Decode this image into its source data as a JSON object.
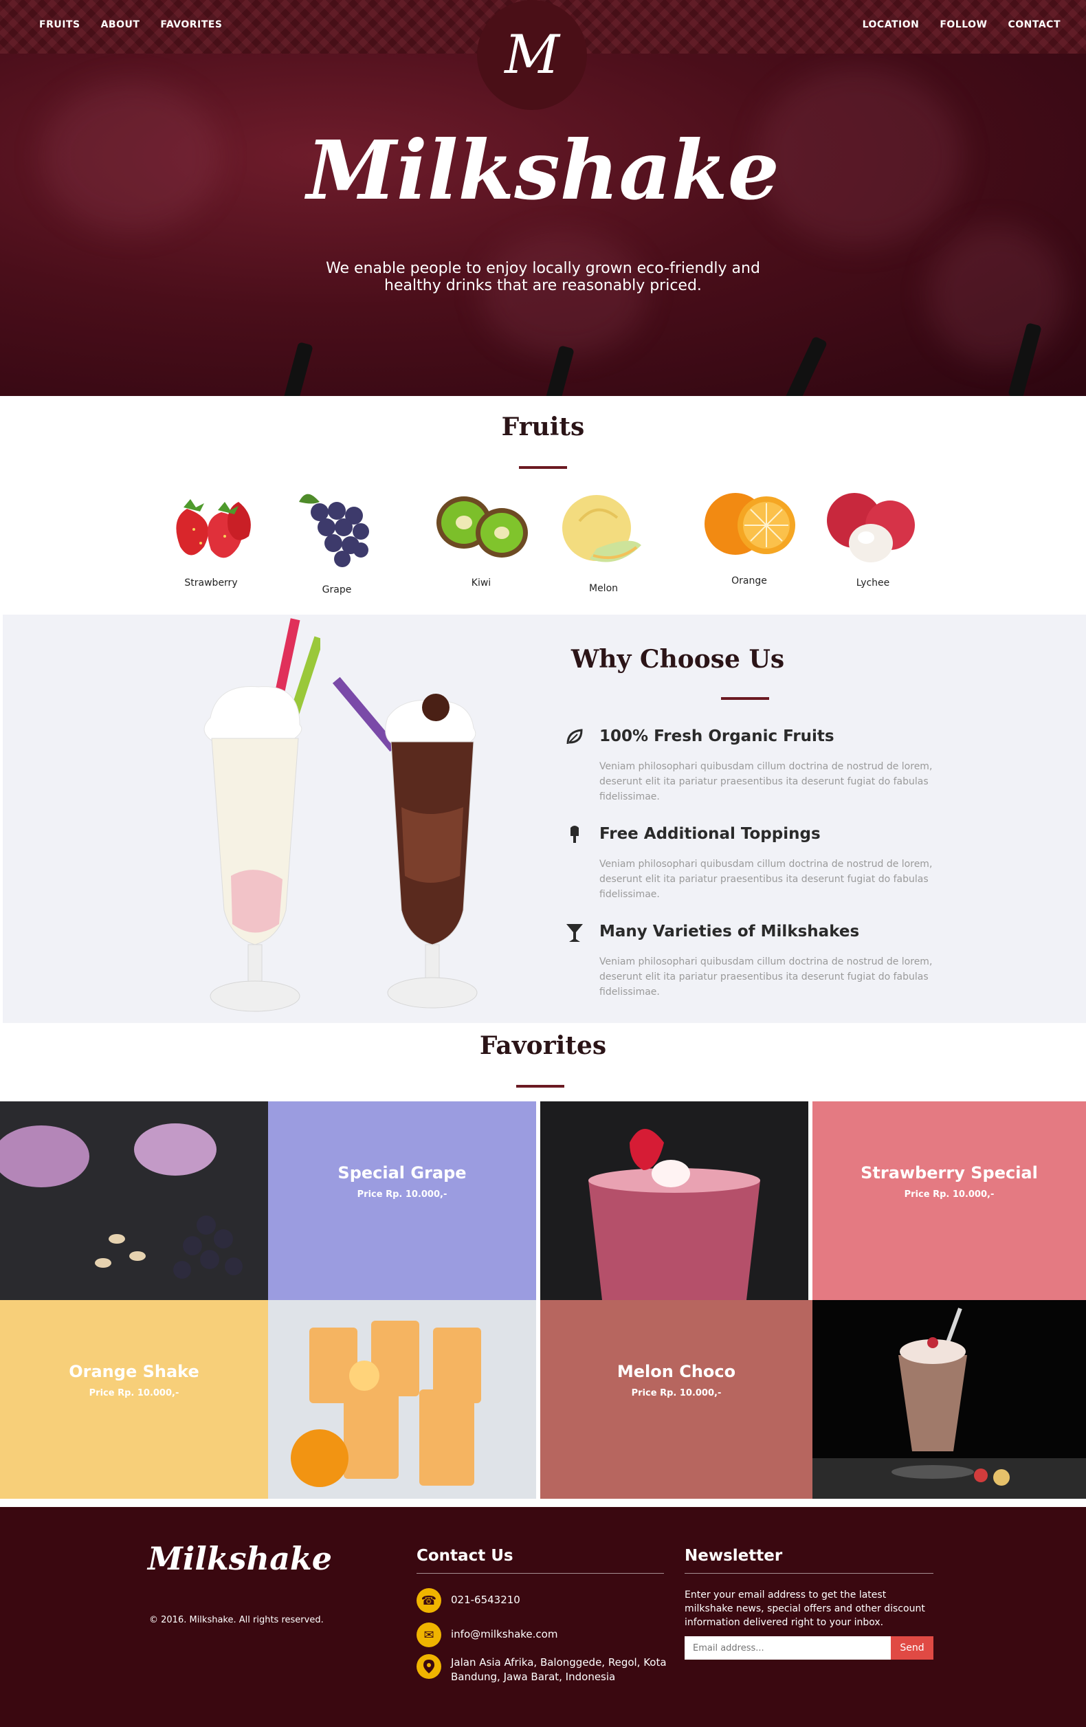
{
  "nav": {
    "left": [
      "FRUITS",
      "ABOUT",
      "FAVORITES"
    ],
    "right": [
      "LOCATION",
      "FOLLOW",
      "CONTACT"
    ],
    "logo_letter": "M"
  },
  "hero": {
    "title": "Milkshake",
    "subtitle": "We enable people to enjoy locally grown eco-friendly and healthy drinks that are reasonably priced."
  },
  "fruits": {
    "title": "Fruits",
    "items": [
      "Strawberry",
      "Grape",
      "Kiwi",
      "Melon",
      "Orange",
      "Lychee"
    ]
  },
  "why": {
    "title": "Why Choose Us",
    "features": [
      {
        "icon": "leaf-icon",
        "title": "100% Fresh Organic Fruits",
        "text": "Veniam philosophari quibusdam cillum doctrina de nostrud de lorem, deserunt elit ita pariatur praesentibus ita deserunt fugiat do fabulas fidelissimae."
      },
      {
        "icon": "popsicle-icon",
        "title": "Free Additional Toppings",
        "text": "Veniam philosophari quibusdam cillum doctrina de nostrud de lorem, deserunt elit ita pariatur praesentibus ita deserunt fugiat do fabulas fidelissimae."
      },
      {
        "icon": "cocktail-icon",
        "title": "Many Varieties of Milkshakes",
        "text": "Veniam philosophari quibusdam cillum doctrina de nostrud de lorem, deserunt elit ita pariatur praesentibus ita deserunt fugiat do fabulas fidelissimae."
      }
    ]
  },
  "favorites": {
    "title": "Favorites",
    "items": [
      {
        "name": "Special Grape",
        "price": "Price Rp. 10.000,-",
        "color": "#9b9ce0"
      },
      {
        "name": "Strawberry Special",
        "price": "Price Rp. 10.000,-",
        "color": "#e47a82"
      },
      {
        "name": "Orange Shake",
        "price": "Price Rp. 10.000,-",
        "color": "#f7cf79"
      },
      {
        "name": "Melon Choco",
        "price": "Price Rp. 10.000,-",
        "color": "#b7665f"
      }
    ]
  },
  "footer": {
    "logo": "Milkshake",
    "copyright": "© 2016. Milkshake. All rights reserved.",
    "contact_title": "Contact Us",
    "phone": "021-6543210",
    "email": "info@milkshake.com",
    "address": "Jalan Asia Afrika, Balonggede, Regol, Kota Bandung, Jawa Barat, Indonesia",
    "newsletter_title": "Newsletter",
    "newsletter_text": "Enter your email address to get the latest milkshake news, special offers and other discount information delivered right to your inbox.",
    "email_placeholder": "Email address...",
    "send_label": "Send"
  },
  "colors": {
    "brand": "#4a0f17",
    "accent_line": "#6b1a22",
    "icon_bg": "#f0b400",
    "send_button": "#e04a44"
  }
}
